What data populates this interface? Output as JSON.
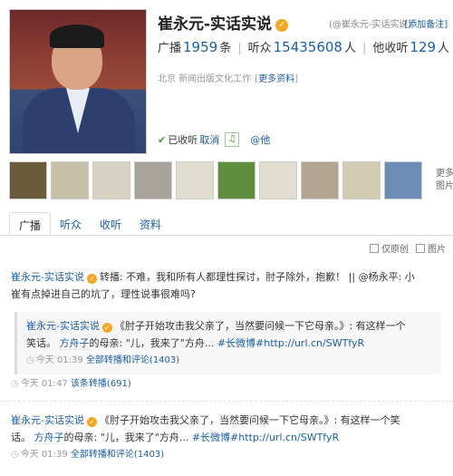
{
  "profile": {
    "name": "崔永元-实话实说",
    "domain": "(@崔永元-实话实说)",
    "add_note": "[添加备注]",
    "stats": {
      "posts_label": "广播",
      "posts": "1959",
      "posts_unit": "条",
      "followers_label": "听众",
      "followers": "15435608",
      "followers_unit": "人",
      "following_label": "他收听",
      "following": "129",
      "following_unit": "人"
    },
    "location": "北京  新闻出版文化工作",
    "more_info": "更多资料",
    "followed": "已收听",
    "cancel": "取消",
    "at": "@他"
  },
  "photos": {
    "more_line1": "更多",
    "more_line2": "图片",
    "tiles": [
      "#6b5b3a",
      "#c9c0a8",
      "#d7d2c4",
      "#a7a29a",
      "#e0dccf",
      "#5f8e3f",
      "#e2ddd1",
      "#b3a58f",
      "#d4cbb3",
      "#6b8db8",
      "#5e5a55",
      "#7a5a3b",
      "#c5b89c"
    ]
  },
  "tabs": [
    "广播",
    "听众",
    "收听",
    "资料"
  ],
  "filters": {
    "original": "仅原创",
    "images": "图片"
  },
  "feed": [
    {
      "user": "崔永元-实话实说",
      "text_line1": "转播: 不难，我和所有人都理性探讨，肘子除外，抱歉！ || @杨永平: 小",
      "text_line2": "崔有点掉进自己的坑了，理性说事很难吗?",
      "repost": {
        "user": "崔永元-实话实说",
        "quote_line1": "《肘子开始攻击我父亲了，当然要问候一下它母亲。》: 有这样一个",
        "quote_line2_a": "笑话。",
        "quote_line2_b": "方舟子",
        "quote_line2_c": "的母亲: \"儿，我来了\"方舟...",
        "topic": "#长微博",
        "link": "#http://url.cn/SWTfyR",
        "meta_time": "今天 01:39",
        "meta_link": "全部转播和评论(1403)"
      },
      "meta_time": "今天 01:47",
      "meta_link": "该条转播(691)"
    },
    {
      "user": "崔永元-实话实说",
      "text_line1": "《肘子开始攻击我父亲了，当然要问候一下它母亲。》: 有这样一个笑",
      "text_line2_a": "话。",
      "text_line2_b": "方舟子",
      "text_line2_c": "的母亲: \"儿，我来了\"方舟...",
      "topic": "#长微博",
      "link": "#http://url.cn/SWTfyR",
      "meta_time": "今天 01:39",
      "meta_link": "全部转播和评论(1403)"
    }
  ]
}
